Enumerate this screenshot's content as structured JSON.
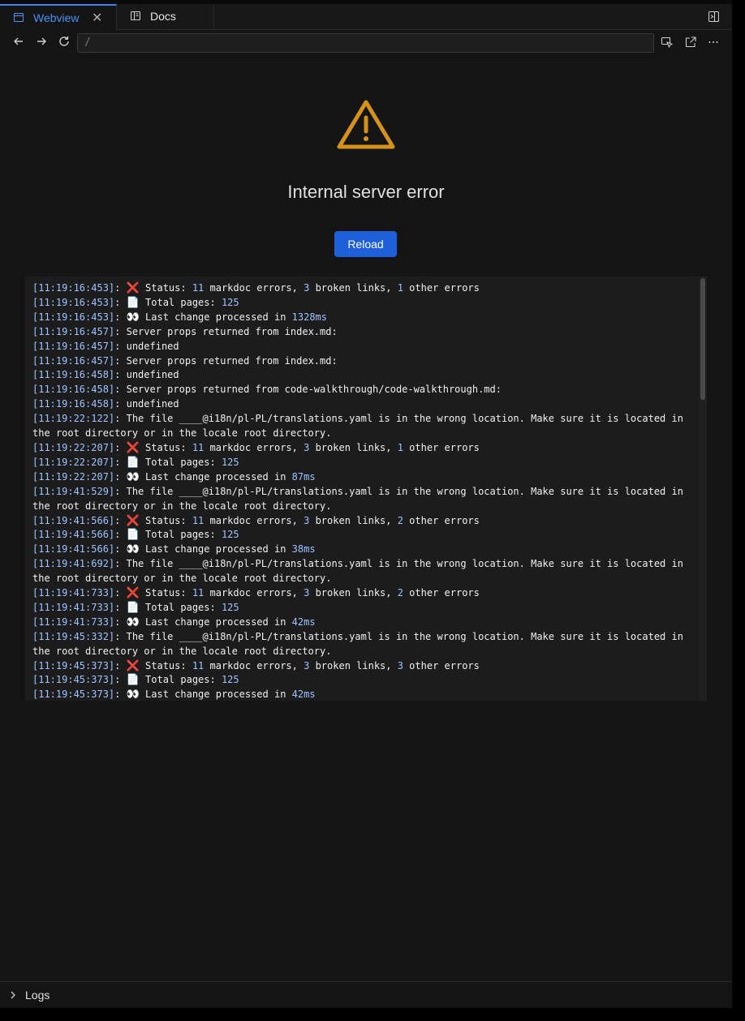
{
  "tabs": [
    {
      "label": "Webview",
      "active": true,
      "icon": "browser-icon"
    },
    {
      "label": "Docs",
      "active": false,
      "icon": "book-icon"
    }
  ],
  "url": "/",
  "error": {
    "title": "Internal server error",
    "reload_label": "Reload",
    "icon": "warning-triangle-icon",
    "accent": "#d4921a"
  },
  "logs": [
    {
      "ts": "[11:19:16:453]",
      "parts": [
        {
          "t": ": "
        },
        {
          "t": "❌",
          "e": 1
        },
        {
          "t": " Status: "
        },
        {
          "t": "11",
          "n": 1
        },
        {
          "t": " markdoc errors, "
        },
        {
          "t": "3",
          "n": 1
        },
        {
          "t": " broken links, "
        },
        {
          "t": "1",
          "n": 1
        },
        {
          "t": " other errors"
        }
      ]
    },
    {
      "ts": "[11:19:16:453]",
      "parts": [
        {
          "t": ": "
        },
        {
          "t": "📄",
          "e": 1
        },
        {
          "t": " Total pages: "
        },
        {
          "t": "125",
          "n": 1
        }
      ]
    },
    {
      "ts": "[11:19:16:453]",
      "parts": [
        {
          "t": ": "
        },
        {
          "t": "👀",
          "e": 1
        },
        {
          "t": " Last change processed in "
        },
        {
          "t": "1328ms",
          "n": 1
        }
      ]
    },
    {
      "ts": "[11:19:16:457]",
      "parts": [
        {
          "t": ": Server props returned from index.md:"
        }
      ]
    },
    {
      "ts": "[11:19:16:457]",
      "parts": [
        {
          "t": ": undefined"
        }
      ]
    },
    {
      "ts": "[11:19:16:457]",
      "parts": [
        {
          "t": ": Server props returned from index.md:"
        }
      ]
    },
    {
      "ts": "[11:19:16:458]",
      "parts": [
        {
          "t": ": undefined"
        }
      ]
    },
    {
      "ts": "[11:19:16:458]",
      "parts": [
        {
          "t": ": Server props returned from code-walkthrough/code-walkthrough.md:"
        }
      ]
    },
    {
      "ts": "[11:19:16:458]",
      "parts": [
        {
          "t": ": undefined"
        }
      ]
    },
    {
      "ts": "[11:19:22:122]",
      "parts": [
        {
          "t": ": The file ____@i18n/pl-PL/translations.yaml is in the wrong location. Make sure it is located in the root directory or in the locale root directory."
        }
      ]
    },
    {
      "ts": "[11:19:22:207]",
      "parts": [
        {
          "t": ": "
        },
        {
          "t": "❌",
          "e": 1
        },
        {
          "t": " Status: "
        },
        {
          "t": "11",
          "n": 1
        },
        {
          "t": " markdoc errors, "
        },
        {
          "t": "3",
          "n": 1
        },
        {
          "t": " broken links, "
        },
        {
          "t": "1",
          "n": 1
        },
        {
          "t": " other errors"
        }
      ]
    },
    {
      "ts": "[11:19:22:207]",
      "parts": [
        {
          "t": ": "
        },
        {
          "t": "📄",
          "e": 1
        },
        {
          "t": " Total pages: "
        },
        {
          "t": "125",
          "n": 1
        }
      ]
    },
    {
      "ts": "[11:19:22:207]",
      "parts": [
        {
          "t": ": "
        },
        {
          "t": "👀",
          "e": 1
        },
        {
          "t": " Last change processed in "
        },
        {
          "t": "87ms",
          "n": 1
        }
      ]
    },
    {
      "ts": "[11:19:41:529]",
      "parts": [
        {
          "t": ": The file ____@i18n/pl-PL/translations.yaml is in the wrong location. Make sure it is located in the root directory or in the locale root directory."
        }
      ]
    },
    {
      "ts": "[11:19:41:566]",
      "parts": [
        {
          "t": ": "
        },
        {
          "t": "❌",
          "e": 1
        },
        {
          "t": " Status: "
        },
        {
          "t": "11",
          "n": 1
        },
        {
          "t": " markdoc errors, "
        },
        {
          "t": "3",
          "n": 1
        },
        {
          "t": " broken links, "
        },
        {
          "t": "2",
          "n": 1
        },
        {
          "t": " other errors"
        }
      ]
    },
    {
      "ts": "[11:19:41:566]",
      "parts": [
        {
          "t": ": "
        },
        {
          "t": "📄",
          "e": 1
        },
        {
          "t": " Total pages: "
        },
        {
          "t": "125",
          "n": 1
        }
      ]
    },
    {
      "ts": "[11:19:41:566]",
      "parts": [
        {
          "t": ": "
        },
        {
          "t": "👀",
          "e": 1
        },
        {
          "t": " Last change processed in "
        },
        {
          "t": "38ms",
          "n": 1
        }
      ]
    },
    {
      "ts": "[11:19:41:692]",
      "parts": [
        {
          "t": ": The file ____@i18n/pl-PL/translations.yaml is in the wrong location. Make sure it is located in the root directory or in the locale root directory."
        }
      ]
    },
    {
      "ts": "[11:19:41:733]",
      "parts": [
        {
          "t": ": "
        },
        {
          "t": "❌",
          "e": 1
        },
        {
          "t": " Status: "
        },
        {
          "t": "11",
          "n": 1
        },
        {
          "t": " markdoc errors, "
        },
        {
          "t": "3",
          "n": 1
        },
        {
          "t": " broken links, "
        },
        {
          "t": "2",
          "n": 1
        },
        {
          "t": " other errors"
        }
      ]
    },
    {
      "ts": "[11:19:41:733]",
      "parts": [
        {
          "t": ": "
        },
        {
          "t": "📄",
          "e": 1
        },
        {
          "t": " Total pages: "
        },
        {
          "t": "125",
          "n": 1
        }
      ]
    },
    {
      "ts": "[11:19:41:733]",
      "parts": [
        {
          "t": ": "
        },
        {
          "t": "👀",
          "e": 1
        },
        {
          "t": " Last change processed in "
        },
        {
          "t": "42ms",
          "n": 1
        }
      ]
    },
    {
      "ts": "[11:19:45:332]",
      "parts": [
        {
          "t": ": The file ____@i18n/pl-PL/translations.yaml is in the wrong location. Make sure it is located in the root directory or in the locale root directory."
        }
      ]
    },
    {
      "ts": "[11:19:45:373]",
      "parts": [
        {
          "t": ": "
        },
        {
          "t": "❌",
          "e": 1
        },
        {
          "t": " Status: "
        },
        {
          "t": "11",
          "n": 1
        },
        {
          "t": " markdoc errors, "
        },
        {
          "t": "3",
          "n": 1
        },
        {
          "t": " broken links, "
        },
        {
          "t": "3",
          "n": 1
        },
        {
          "t": " other errors"
        }
      ]
    },
    {
      "ts": "[11:19:45:373]",
      "parts": [
        {
          "t": ": "
        },
        {
          "t": "📄",
          "e": 1
        },
        {
          "t": " Total pages: "
        },
        {
          "t": "125",
          "n": 1
        }
      ]
    },
    {
      "ts": "[11:19:45:373]",
      "parts": [
        {
          "t": ": "
        },
        {
          "t": "👀",
          "e": 1
        },
        {
          "t": " Last change processed in "
        },
        {
          "t": "42ms",
          "n": 1
        }
      ]
    }
  ],
  "bottom_panel": {
    "label": "Logs"
  },
  "colors": {
    "tab_active": "#4a90f5",
    "button": "#1f5fd9",
    "timestamp": "#9ec3ff"
  }
}
